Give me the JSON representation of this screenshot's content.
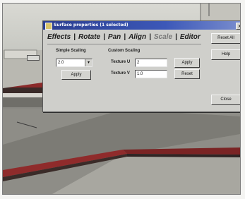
{
  "dialog": {
    "title": "Surface properties (1 selected)",
    "close_glyph": "x",
    "tabs": [
      {
        "label": "Effects",
        "active": false
      },
      {
        "label": "Rotate",
        "active": false
      },
      {
        "label": "Pan",
        "active": false
      },
      {
        "label": "Align",
        "active": false
      },
      {
        "label": "Scale",
        "active": true
      },
      {
        "label": "Editor",
        "active": false
      }
    ],
    "simple_scaling": {
      "heading": "Simple Scaling",
      "value": "2.0",
      "arrow": "▾",
      "apply_label": "Apply"
    },
    "custom_scaling": {
      "heading": "Custom Scaling",
      "u_label": "Texture U",
      "u_value": "2",
      "v_label": "Texture V",
      "v_value": "1.0",
      "apply_label": "Apply",
      "reset_label": "Reset"
    },
    "side_buttons": {
      "reset_all": "Reset All",
      "help": "Help",
      "close": "Close"
    }
  },
  "colors": {
    "titlebar": "#2a3d8f",
    "dialog_face": "#cfcfcb",
    "rail_red": "#8b2a2a",
    "floor": "#8e8d87"
  },
  "icons": {
    "title_icon": "window-icon",
    "toolbar_button": "tool-icon"
  }
}
